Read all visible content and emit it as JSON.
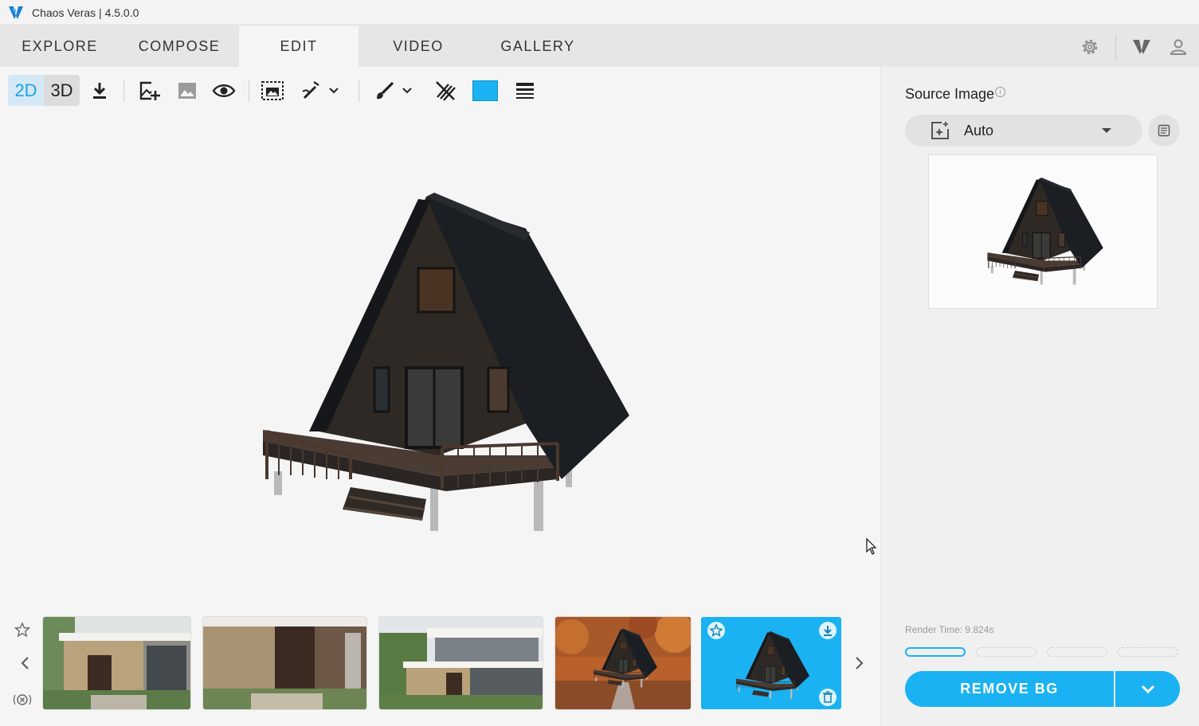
{
  "window": {
    "title": "Chaos Veras | 4.5.0.0"
  },
  "tabs": [
    {
      "label": "EXPLORE"
    },
    {
      "label": "COMPOSE"
    },
    {
      "label": "EDIT"
    },
    {
      "label": "VIDEO"
    },
    {
      "label": "GALLERY"
    }
  ],
  "active_tab": "EDIT",
  "toolbar": {
    "mode_2d": "2D",
    "mode_3d": "3D",
    "active_mode": "2D",
    "swatch_color": "#1ab2f2"
  },
  "side_panel": {
    "source_label": "Source Image",
    "source_select_value": "Auto",
    "render_time": "Render Time: 9.824s",
    "remove_bg_label": "REMOVE BG",
    "progress_segments": 4,
    "progress_filled": 1
  },
  "colors": {
    "accent": "#1ab2f2",
    "roof": "#1b1e22",
    "wall": "#2e2924",
    "deck": "#4a3b33"
  },
  "thumbnails": [
    {
      "name": "modern-house-1"
    },
    {
      "name": "modern-house-2"
    },
    {
      "name": "modern-house-3"
    },
    {
      "name": "a-frame-autumn"
    },
    {
      "name": "a-frame-no-bg",
      "selected": true
    }
  ]
}
